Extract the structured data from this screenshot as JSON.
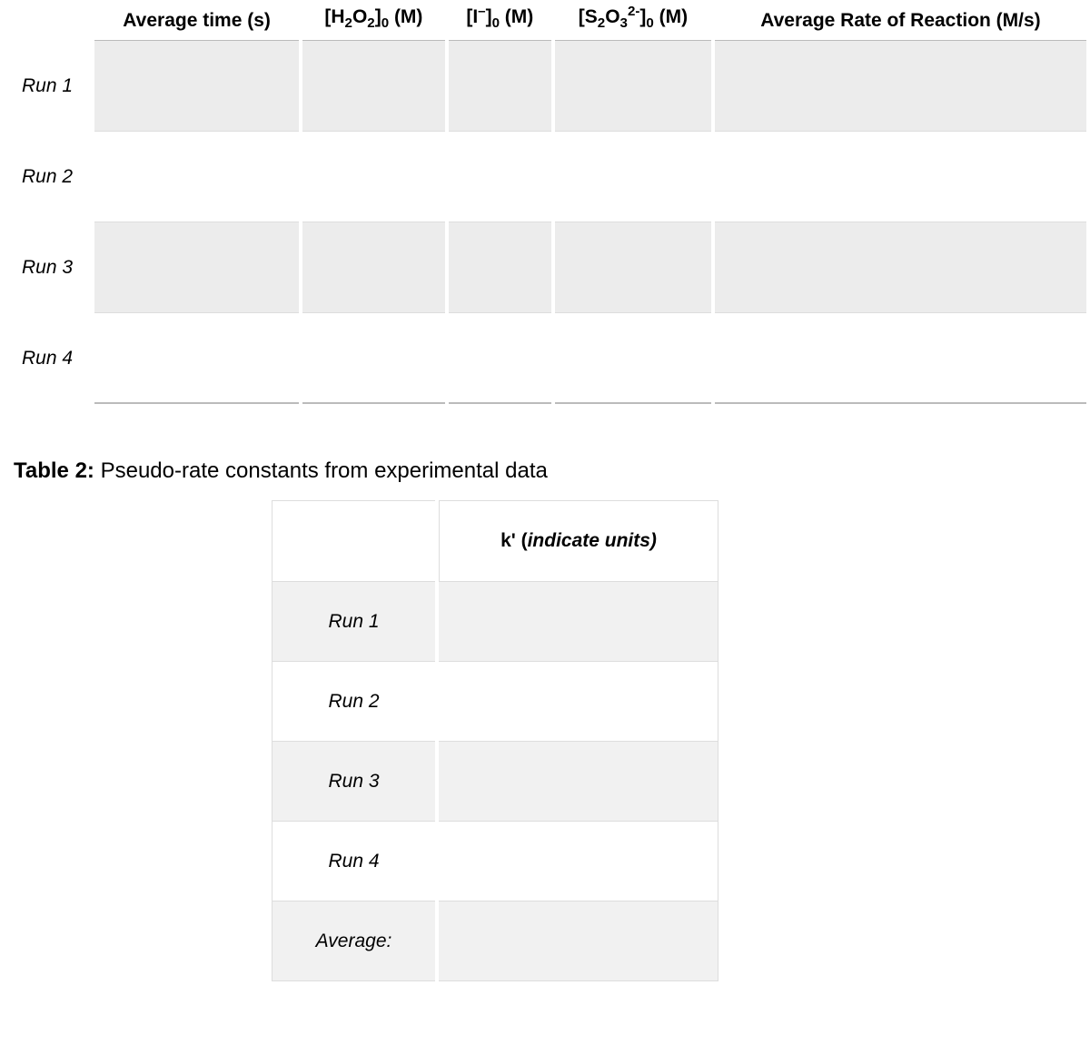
{
  "table1": {
    "headers": {
      "blank": "",
      "avg_time": "Average time (s)",
      "rate": "Average Rate of Reaction (M/s)"
    },
    "rows": [
      {
        "label": "Run 1",
        "avg_time": "",
        "h2o2": "",
        "i": "",
        "s2o3": "",
        "rate": ""
      },
      {
        "label": "Run 2",
        "avg_time": "",
        "h2o2": "",
        "i": "",
        "s2o3": "",
        "rate": ""
      },
      {
        "label": "Run 3",
        "avg_time": "",
        "h2o2": "",
        "i": "",
        "s2o3": "",
        "rate": ""
      },
      {
        "label": "Run 4",
        "avg_time": "",
        "h2o2": "",
        "i": "",
        "s2o3": "",
        "rate": ""
      }
    ]
  },
  "table2": {
    "caption_bold": "Table 2:",
    "caption_rest": " Pseudo-rate constants from experimental data",
    "header_k_prefix": "k' (",
    "header_k_ital": "indicate units)",
    "rows": [
      {
        "label": "Run 1",
        "k": ""
      },
      {
        "label": "Run 2",
        "k": ""
      },
      {
        "label": "Run 3",
        "k": ""
      },
      {
        "label": "Run 4",
        "k": ""
      },
      {
        "label": "Average:",
        "k": ""
      }
    ]
  }
}
